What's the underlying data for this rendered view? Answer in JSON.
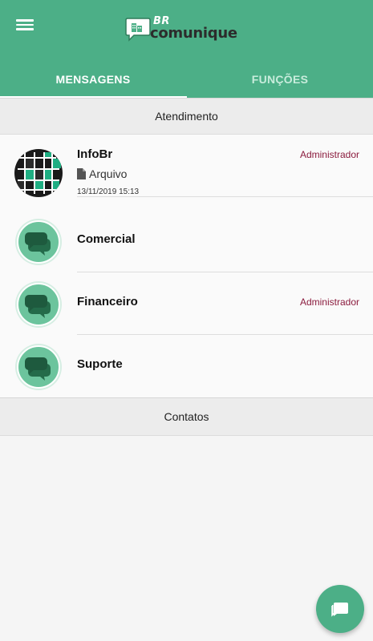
{
  "header": {
    "menu_icon": "hamburger-menu-icon",
    "logo_prefix": "BR",
    "logo_word": "comunique"
  },
  "tabs": [
    {
      "label": "MENSAGENS",
      "active": true
    },
    {
      "label": "FUNÇÕES",
      "active": false
    }
  ],
  "sections": {
    "atendimento": "Atendimento",
    "contatos": "Contatos"
  },
  "conversations": [
    {
      "name": "InfoBr",
      "role": "Administrador",
      "last_message": "Arquivo",
      "last_message_icon": "file-icon",
      "timestamp": "13/11/2019 15:13",
      "avatar": "infobr-logo"
    },
    {
      "name": "Comercial",
      "role": "",
      "avatar": "chat-bubbles-icon"
    },
    {
      "name": "Financeiro",
      "role": "Administrador",
      "avatar": "chat-bubbles-icon"
    },
    {
      "name": "Suporte",
      "role": "",
      "avatar": "chat-bubbles-icon"
    }
  ],
  "fab": {
    "icon": "new-chat-icon"
  },
  "colors": {
    "primary": "#4caf87",
    "role_text": "#8b1c3e",
    "section_bg": "#ececec",
    "list_bg": "#fafafa"
  }
}
